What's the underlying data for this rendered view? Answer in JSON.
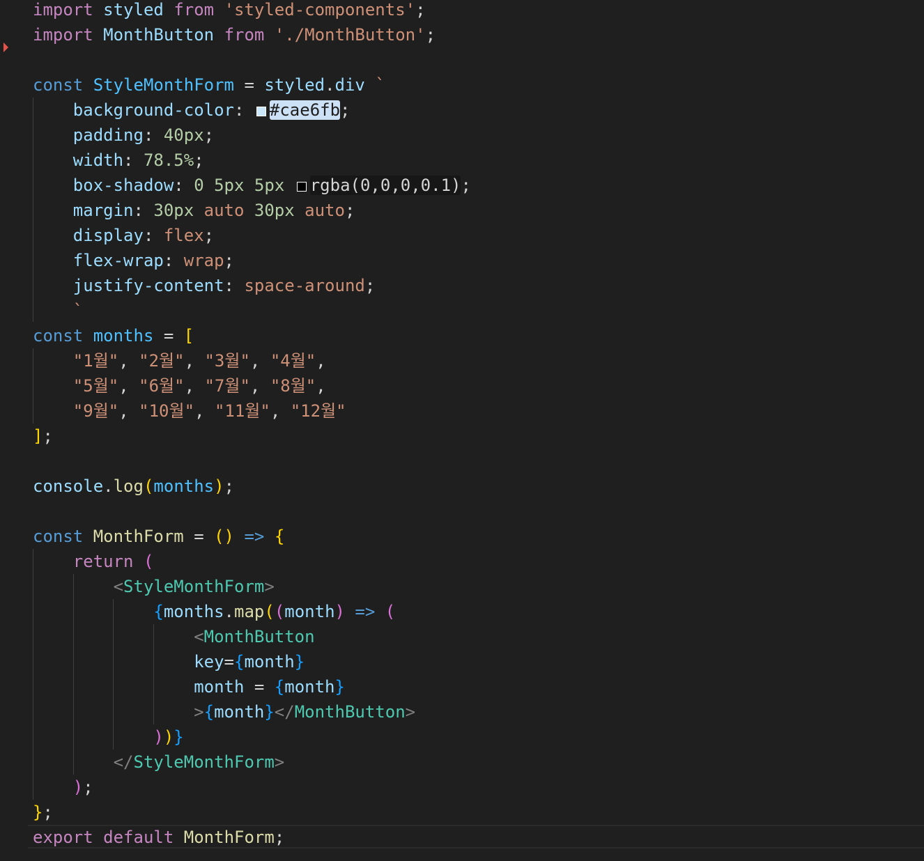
{
  "code": {
    "import_kw": "import",
    "from_kw": "from",
    "const_kw": "const",
    "return_kw": "return",
    "export_kw": "export",
    "default_kw": "default",
    "styled_ident": "styled",
    "styled_module": "'styled-components'",
    "monthbutton_ident": "MonthButton",
    "monthbutton_module": "'./MonthButton'",
    "stylemonthform_ident": "StyleMonthForm",
    "div_prop": "div",
    "backtick": "`",
    "css": {
      "background_prop": "background-color",
      "background_value": "#cae6fb",
      "background_swatch": "#cae6fb",
      "padding_prop": "padding",
      "padding_value": "40px",
      "width_prop": "width",
      "width_value": "78.5%",
      "shadow_prop": "box-shadow",
      "shadow_zero": "0",
      "shadow_x": "5px",
      "shadow_y": "5px",
      "shadow_color": "rgba(0,0,0,0.1)",
      "shadow_swatch": "#000000",
      "margin_prop": "margin",
      "margin_v1": "30px",
      "margin_auto": "auto",
      "margin_v2": "30px",
      "display_prop": "display",
      "display_value": "flex",
      "flexwrap_prop": "flex-wrap",
      "flexwrap_value": "wrap",
      "justify_prop": "justify-content",
      "justify_value": "space-around"
    },
    "months_ident": "months",
    "month_strings": [
      "\"1월\"",
      "\"2월\"",
      "\"3월\"",
      "\"4월\"",
      "\"5월\"",
      "\"6월\"",
      "\"7월\"",
      "\"8월\"",
      "\"9월\"",
      "\"10월\"",
      "\"11월\"",
      "\"12월\""
    ],
    "console_ident": "console",
    "log_fn": "log",
    "monthform_ident": "MonthForm",
    "map_fn": "map",
    "month_param": "month",
    "key_attr": "key",
    "month_attr": "month"
  }
}
